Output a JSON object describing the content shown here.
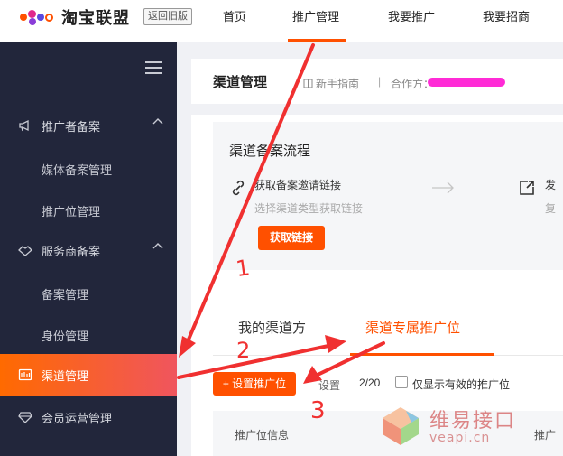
{
  "brand": {
    "name": "淘宝联盟",
    "back_old": "返回旧版"
  },
  "nav": [
    {
      "label": "首页"
    },
    {
      "label": "推广管理"
    },
    {
      "label": "我要推广"
    },
    {
      "label": "我要招商"
    }
  ],
  "sidebar": {
    "groups": [
      {
        "label": "推广者备案",
        "icon": "megaphone-icon"
      },
      {
        "label": "服务商备案",
        "icon": "handshake-icon"
      }
    ],
    "subitems": [
      "媒体备案管理",
      "推广位管理",
      "备案管理",
      "身份管理"
    ],
    "active": {
      "label": "渠道管理",
      "icon": "channel-icon"
    },
    "bottom": {
      "label": "会员运营管理",
      "icon": "diamond-icon"
    }
  },
  "header": {
    "title": "渠道管理",
    "guide": "新手指南",
    "separator": "|",
    "partner_label": "合作方："
  },
  "flow": {
    "title": "渠道备案流程",
    "step1": {
      "title": "获取备案邀请链接",
      "desc": "选择渠道类型获取链接",
      "button": "获取链接"
    },
    "step2": {
      "title": "发",
      "desc": "复"
    }
  },
  "tabs": {
    "tab1": "我的渠道方",
    "tab2": "渠道专属推广位",
    "set_button": "+ 设置推广位",
    "count_label": "设置",
    "count_value": "2/20",
    "checkbox_label": "仅显示有效的推广位",
    "th1": "推广位信息",
    "th2": "推广"
  },
  "annotations": {
    "n1": "1",
    "n2": "2",
    "n3": "3"
  },
  "watermark": {
    "text": "维易接口",
    "url": "veapi.cn"
  },
  "colors": {
    "accent": "#ff5000",
    "sidebar_bg": "#22263b",
    "annotation_red": "#f03030",
    "redaction": "#ff2bd6"
  }
}
